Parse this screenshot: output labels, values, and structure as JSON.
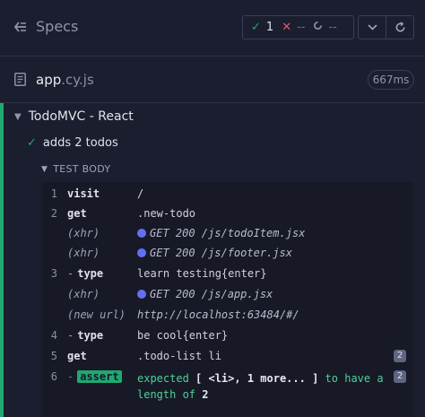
{
  "header": {
    "title": "Specs",
    "stats": {
      "passed": "1",
      "failed": "--",
      "pending": "--"
    }
  },
  "file": {
    "name": "app",
    "ext": ".cy.js",
    "duration": "667ms"
  },
  "suite": {
    "title": "TodoMVC - React"
  },
  "test": {
    "title": "adds 2 todos"
  },
  "section": {
    "title": "TEST BODY"
  },
  "commands": [
    {
      "num": "1",
      "cmd": "visit",
      "msg": "/"
    },
    {
      "num": "2",
      "cmd": "get",
      "msg": ".new-todo"
    },
    {
      "num": "",
      "cmd": "(xhr)",
      "msg": "GET 200 /js/todoItem.jsx"
    },
    {
      "num": "",
      "cmd": "(xhr)",
      "msg": "GET 200 /js/footer.jsx"
    },
    {
      "num": "3",
      "cmd": "-type",
      "msg": "learn testing{enter}"
    },
    {
      "num": "",
      "cmd": "(xhr)",
      "msg": "GET 200 /js/app.jsx"
    },
    {
      "num": "",
      "cmd": "(new url)",
      "msg": "http://localhost:63484/#/"
    },
    {
      "num": "4",
      "cmd": "-type",
      "msg": "be cool{enter}"
    },
    {
      "num": "5",
      "cmd": "get",
      "msg": ".todo-list li",
      "badge": "2"
    },
    {
      "num": "6",
      "cmd": "-assert",
      "msg1": "expected",
      "msg2": "[ <li>, 1 more... ]",
      "msg3": "to have a",
      "msg4": "length of",
      "msg5": "2",
      "badge": "2"
    }
  ],
  "colors": {
    "pass": "#1fa971",
    "fail": "#e45770",
    "xhr_dot": "#6470f3"
  },
  "icons": [
    "specs-back-icon",
    "check-icon",
    "x-icon",
    "spinner-icon",
    "chevron-down-icon",
    "refresh-icon",
    "file-icon"
  ]
}
